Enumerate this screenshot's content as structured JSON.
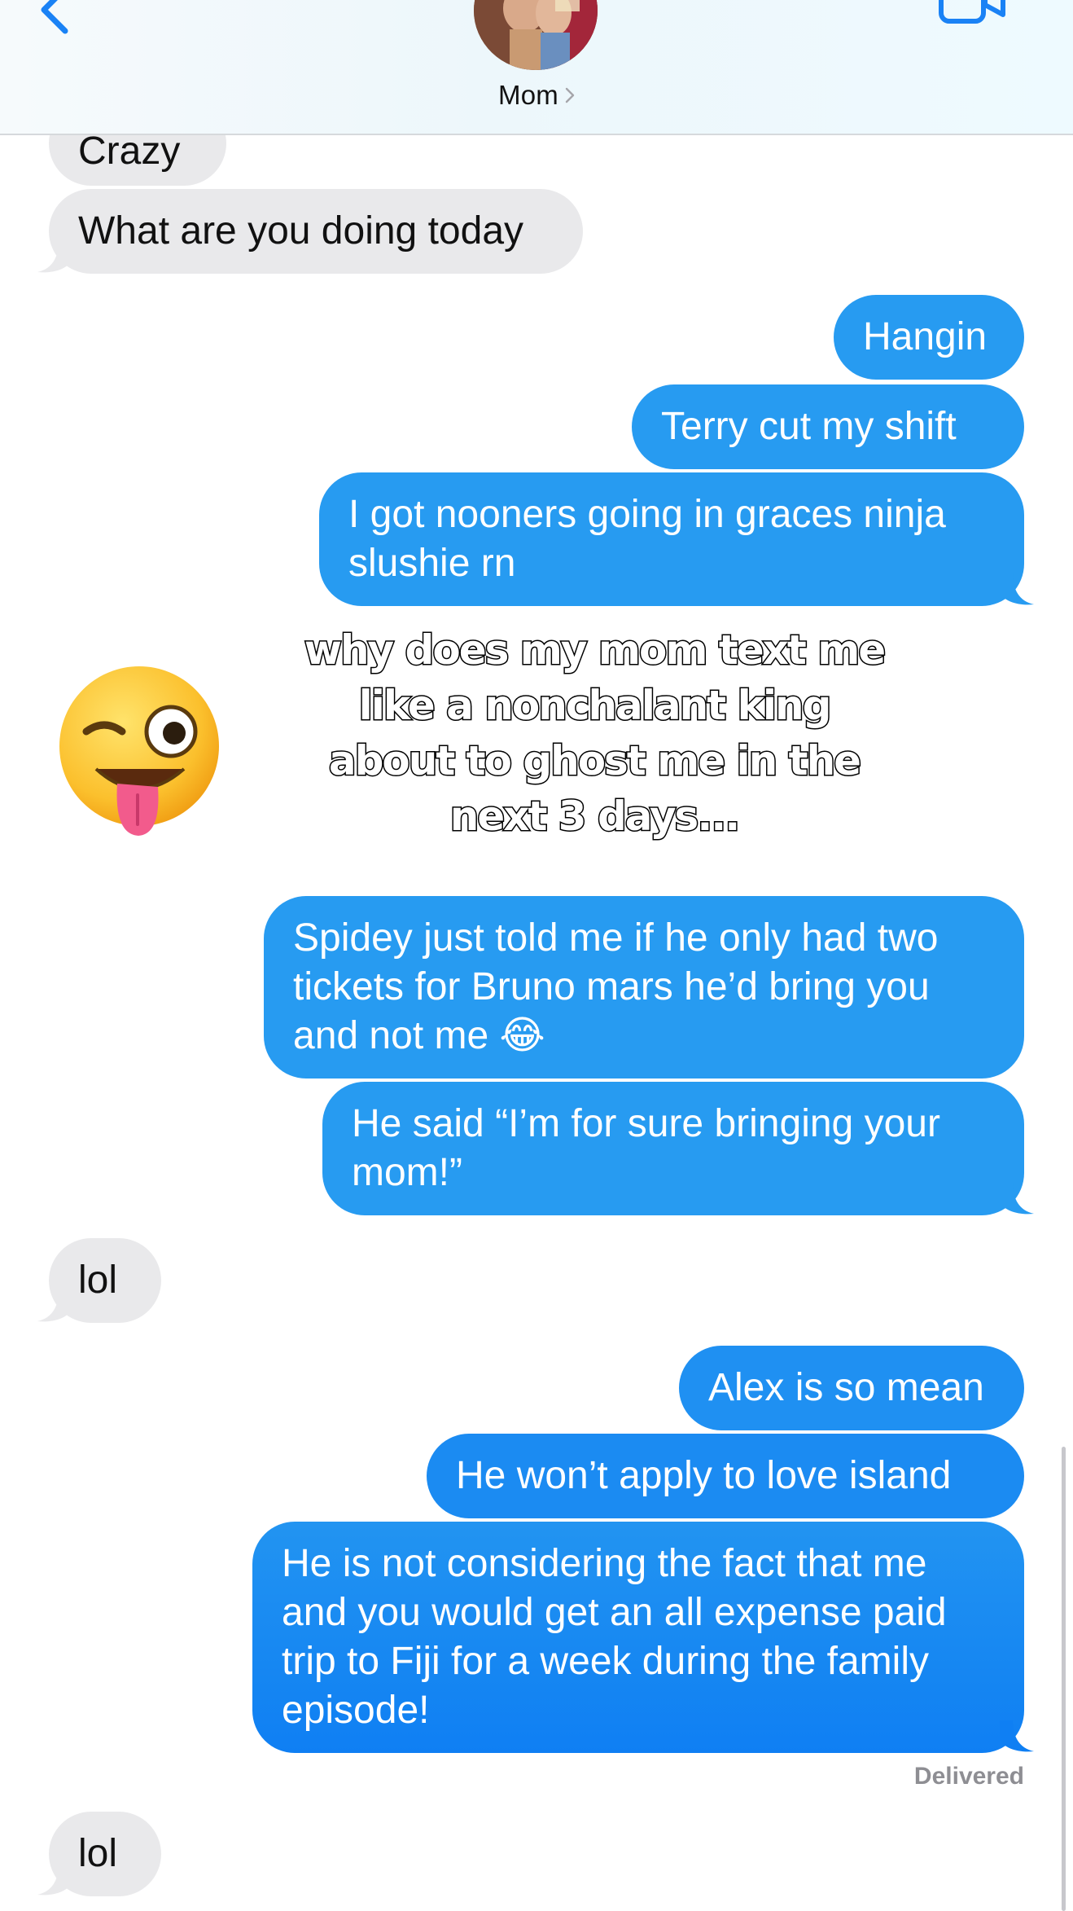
{
  "header": {
    "contact_name": "Mom",
    "back_icon": "chevron-left-icon",
    "video_icon": "facetime-video-icon",
    "accent_color": "#1a82f5"
  },
  "messages": [
    {
      "id": "m1",
      "direction": "received",
      "text": "Crazy"
    },
    {
      "id": "m2",
      "direction": "received",
      "text": "What are you doing today"
    },
    {
      "id": "m3",
      "direction": "sent",
      "text": "Hangin"
    },
    {
      "id": "m4",
      "direction": "sent",
      "text": "Terry cut my shift"
    },
    {
      "id": "m5",
      "direction": "sent",
      "text": "I got nooners going in graces ninja slushie rn"
    },
    {
      "id": "m6",
      "direction": "sent",
      "text": "Spidey just told me if he only had two tickets for Bruno mars he’d bring you and not me 😂"
    },
    {
      "id": "m7",
      "direction": "sent",
      "text": "He said “I’m for sure bringing your mom!”"
    },
    {
      "id": "m8",
      "direction": "received",
      "text": "lol"
    },
    {
      "id": "m9",
      "direction": "sent",
      "text": "Alex is so mean"
    },
    {
      "id": "m10",
      "direction": "sent",
      "text": "He won’t apply to love island"
    },
    {
      "id": "m11",
      "direction": "sent",
      "text": "He is not considering the fact that me and you would get an all expense paid trip to Fiji for a week during the family episode!"
    },
    {
      "id": "m12",
      "direction": "received",
      "text": "lol"
    }
  ],
  "status": {
    "delivered_label": "Delivered"
  },
  "overlay": {
    "caption": "why does my mom text me like a nonchalant king about to ghost me in the next 3 days...",
    "emoji": "winking-face-with-tongue-icon"
  },
  "colors": {
    "sent_bubble": "#279bf1",
    "received_bubble": "#e9e9eb",
    "delivered_text": "#8e8e93"
  }
}
